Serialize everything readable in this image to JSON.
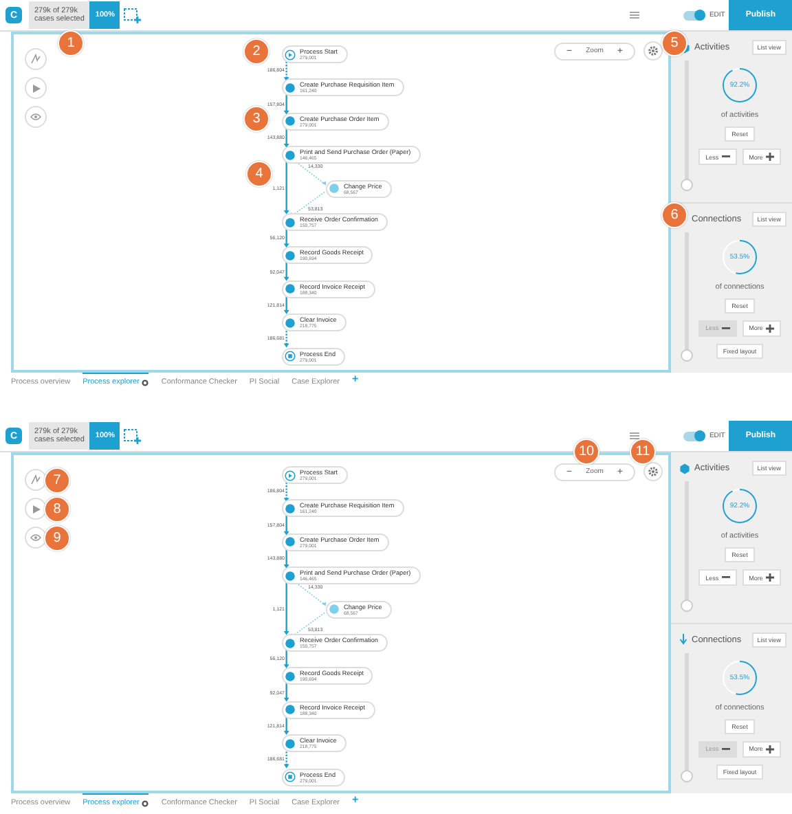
{
  "panels": [
    {
      "header": {
        "logo": "C",
        "selection_count": "279k of 279k",
        "selection_label": "cases selected",
        "percent": "100%",
        "callout": "1",
        "edit_label": "EDIT",
        "edit_on": true,
        "publish": "Publish"
      },
      "tools": [
        {
          "kind": "sparkle"
        },
        {
          "kind": "play"
        },
        {
          "kind": "eye"
        }
      ],
      "zoom": {
        "minus": "−",
        "label": "Zoom",
        "plus": "+"
      },
      "nodes": [
        {
          "kind": "start",
          "label": "Process Start",
          "count": "279,001",
          "callout": "2"
        },
        {
          "kind": "activity",
          "label": "Create Purchase Requisition Item",
          "count": "161,240"
        },
        {
          "kind": "activity",
          "label": "Create Purchase Order Item",
          "count": "279,001",
          "callout": "3"
        },
        {
          "kind": "activity",
          "label": "Print and Send Purchase Order (Paper)",
          "count": "146,465"
        },
        {
          "kind": "branch",
          "label": "Change Price",
          "count": "68,567",
          "in_label": "14,330",
          "out_label": "53,813",
          "callout": "4"
        },
        {
          "kind": "activity",
          "label": "Receive Order Confirmation",
          "count": "150,757"
        },
        {
          "kind": "activity",
          "label": "Record Goods Receipt",
          "count": "190,694"
        },
        {
          "kind": "activity",
          "label": "Record Invoice Receipt",
          "count": "188,340"
        },
        {
          "kind": "activity",
          "label": "Clear Invoice",
          "count": "218,775"
        },
        {
          "kind": "end",
          "label": "Process End",
          "count": "279,001"
        }
      ],
      "edges": [
        "186,804",
        "157,804",
        "143,880",
        "1,121",
        "56,120",
        "92,047",
        "121,814",
        "186,681"
      ],
      "sections": [
        {
          "kind": "activities",
          "title": "Activities",
          "list_view": "List view",
          "value": "92.2%",
          "caption": "of activities",
          "reset": "Reset",
          "less": {
            "label": "Less",
            "disabled": false
          },
          "more": "More",
          "level": 0,
          "callout": "5"
        },
        {
          "kind": "connections",
          "title": "Connections",
          "list_view": "List view",
          "value": "53.5%",
          "caption": "of connections",
          "reset": "Reset",
          "less": {
            "label": "Less",
            "disabled": true
          },
          "more": "More",
          "fixed_layout": "Fixed layout",
          "level": 0,
          "callout": "6"
        }
      ],
      "tabs": [
        {
          "label": "Process overview",
          "selected": false
        },
        {
          "label": "Process explorer",
          "selected": true
        },
        {
          "label": "Conformance Checker",
          "selected": false
        },
        {
          "label": "PI Social",
          "selected": false
        },
        {
          "label": "Case Explorer",
          "selected": false
        }
      ],
      "add_tab": "+"
    },
    {
      "header": {
        "logo": "C",
        "selection_count": "279k of 279k",
        "selection_label": "cases selected",
        "percent": "100%",
        "edit_label": "EDIT",
        "edit_on": true,
        "publish": "Publish"
      },
      "tools": [
        {
          "kind": "sparkle",
          "callout": "7"
        },
        {
          "kind": "play",
          "callout": "8"
        },
        {
          "kind": "eye",
          "callout": "9"
        }
      ],
      "zoom": {
        "minus": "−",
        "label": "Zoom",
        "plus": "+",
        "callout": "10"
      },
      "settings": {
        "callout": "11"
      },
      "nodes": [
        {
          "kind": "start",
          "label": "Process Start",
          "count": "279,001"
        },
        {
          "kind": "activity",
          "label": "Create Purchase Requisition Item",
          "count": "161,240"
        },
        {
          "kind": "activity",
          "label": "Create Purchase Order Item",
          "count": "279,001"
        },
        {
          "kind": "activity",
          "label": "Print and Send Purchase Order (Paper)",
          "count": "146,465"
        },
        {
          "kind": "branch",
          "label": "Change Price",
          "count": "68,567",
          "in_label": "14,330",
          "out_label": "53,813"
        },
        {
          "kind": "activity",
          "label": "Receive Order Confirmation",
          "count": "150,757"
        },
        {
          "kind": "activity",
          "label": "Record Goods Receipt",
          "count": "190,694"
        },
        {
          "kind": "activity",
          "label": "Record Invoice Receipt",
          "count": "188,340"
        },
        {
          "kind": "activity",
          "label": "Clear Invoice",
          "count": "218,775"
        },
        {
          "kind": "end",
          "label": "Process End",
          "count": "279,001"
        }
      ],
      "edges": [
        "186,804",
        "157,804",
        "143,880",
        "1,121",
        "56,120",
        "92,047",
        "121,814",
        "186,681"
      ],
      "sections": [
        {
          "kind": "activities",
          "title": "Activities",
          "list_view": "List view",
          "value": "92.2%",
          "caption": "of activities",
          "reset": "Reset",
          "less": {
            "label": "Less",
            "disabled": false
          },
          "more": "More",
          "level": 0
        },
        {
          "kind": "connections",
          "title": "Connections",
          "list_view": "List view",
          "value": "53.5%",
          "caption": "of connections",
          "reset": "Reset",
          "less": {
            "label": "Less",
            "disabled": true
          },
          "more": "More",
          "fixed_layout": "Fixed layout",
          "level": 0
        }
      ],
      "tabs": [
        {
          "label": "Process overview",
          "selected": false
        },
        {
          "label": "Process explorer",
          "selected": true
        },
        {
          "label": "Conformance Checker",
          "selected": false
        },
        {
          "label": "PI Social",
          "selected": false
        },
        {
          "label": "Case Explorer",
          "selected": false
        }
      ],
      "add_tab": "+"
    }
  ]
}
